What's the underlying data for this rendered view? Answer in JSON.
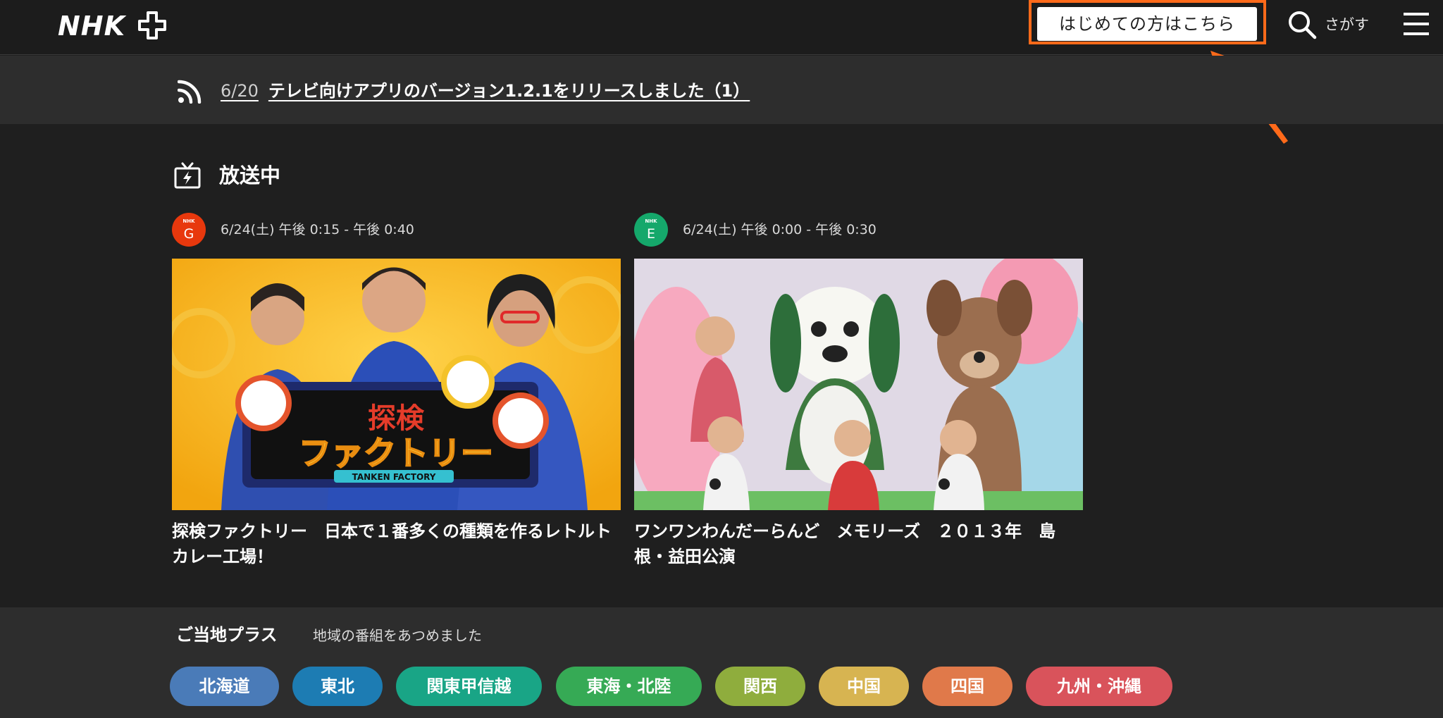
{
  "header": {
    "logo_text": "NHK+",
    "first_time_label": "はじめての方はこちら",
    "search_label": "さがす"
  },
  "news": {
    "date": "6/20",
    "title": "テレビ向けアプリのバージョン1.2.1をリリースしました（1）"
  },
  "on_air": {
    "section_title": "放送中",
    "cards": [
      {
        "channel_small": "NHK",
        "channel_letter": "G",
        "channel_color": "#e8380d",
        "time": "6/24(土) 午後 0:15 - 午後 0:40",
        "title": "探検ファクトリー　日本で１番多くの種類を作るレトルトカレー工場！",
        "thumb_text_1": "探検",
        "thumb_text_2": "ファクトリー",
        "thumb_text_3": "TANKEN FACTORY"
      },
      {
        "channel_small": "NHK",
        "channel_letter": "E",
        "channel_color": "#15a86b",
        "time": "6/24(土) 午後 0:00 - 午後 0:30",
        "title": "ワンワンわんだーらんど　メモリーズ　２０１３年　島根・益田公演"
      }
    ]
  },
  "local_plus": {
    "title": "ご当地プラス",
    "subtitle": "地域の番組をあつめました",
    "regions": [
      {
        "label": "北海道",
        "color": "#4a7bb8"
      },
      {
        "label": "東北",
        "color": "#1d7cb3"
      },
      {
        "label": "関東甲信越",
        "color": "#19a586"
      },
      {
        "label": "東海・北陸",
        "color": "#36aa55"
      },
      {
        "label": "関西",
        "color": "#8fad3d"
      },
      {
        "label": "中国",
        "color": "#d7b451"
      },
      {
        "label": "四国",
        "color": "#e0794a"
      },
      {
        "label": "九州・沖縄",
        "color": "#d9535b"
      }
    ]
  },
  "colors": {
    "highlight": "#ff6a1a",
    "background": "#1f1f1f",
    "bar_background": "#2d2d2d"
  }
}
